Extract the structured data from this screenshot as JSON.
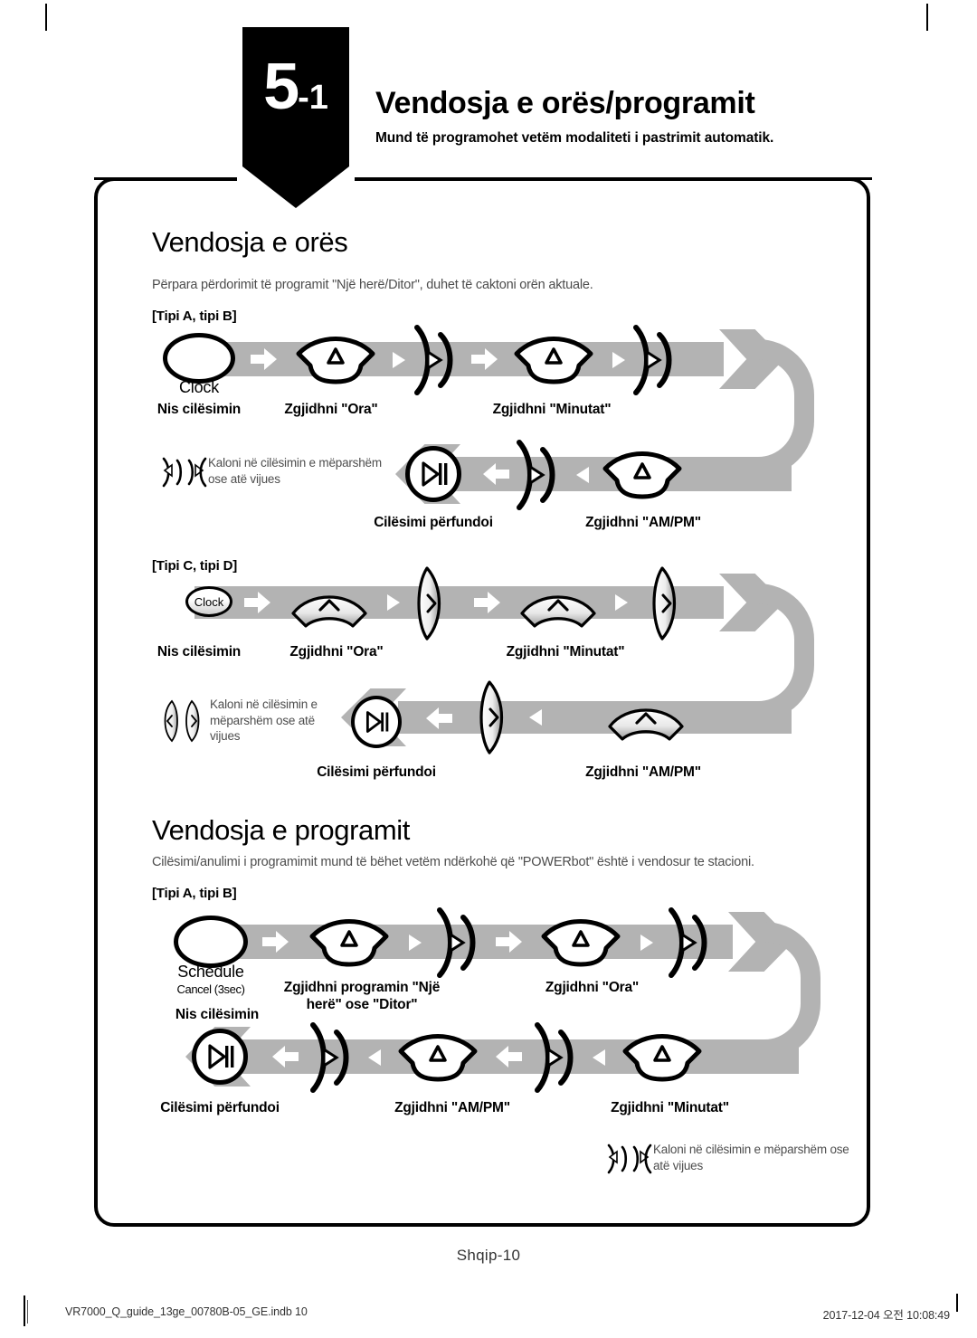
{
  "chapter": {
    "number": "5",
    "sub": "-1"
  },
  "header": {
    "title": "Vendosja e orës/programit",
    "subtitle": "Mund të programohet vetëm modaliteti i pastrimit automatik."
  },
  "sections": [
    {
      "id": "clock",
      "title": "Vendosja e orës",
      "description": "Përpara përdorimit të programit \"Një herë/Ditor\", duhet të caktoni orën aktuale.",
      "groups": [
        {
          "type_label": "[Tipi A, tipi B]",
          "start_button": {
            "label": "Clock"
          },
          "legend": {
            "text": "Kaloni në cilësimin e mëparshëm ose atë vijues",
            "icons": "prev-next-arc-icons"
          },
          "steps_top": [
            "Nis cilësimin",
            "Zgjidhni \"Ora\"",
            "Zgjidhni \"Minutat\""
          ],
          "steps_bottom": [
            "Cilësimi përfundoi",
            "Zgjidhni \"AM/PM\""
          ]
        },
        {
          "type_label": "[Tipi C, tipi D]",
          "start_button": {
            "label": "Clock"
          },
          "legend": {
            "text": "Kaloni në cilësimin e mëparshëm ose atë vijues",
            "icons": "prev-next-diamond-icons"
          },
          "steps_top": [
            "Nis cilësimin",
            "Zgjidhni \"Ora\"",
            "Zgjidhni \"Minutat\""
          ],
          "steps_bottom": [
            "Cilësimi përfundoi",
            "Zgjidhni \"AM/PM\""
          ]
        }
      ]
    },
    {
      "id": "schedule",
      "title": "Vendosja e programit",
      "description": "Cilësimi/anulimi i programimit mund të bëhet vetëm ndërkohë që \"POWERbot\" është i vendosur te stacioni.",
      "groups": [
        {
          "type_label": "[Tipi A, tipi B]",
          "start_button": {
            "label": "Schedule",
            "sublabel": "Cancel (3sec)"
          },
          "legend": {
            "text": "Kaloni në cilësimin e mëparshëm ose atë vijues",
            "icons": "prev-next-arc-icons"
          },
          "steps_top": [
            "Nis cilësimin",
            "Zgjidhni programin \"Një herë\" ose \"Ditor\"",
            "Zgjidhni \"Ora\""
          ],
          "steps_bottom": [
            "Cilësimi përfundoi",
            "Zgjidhni \"AM/PM\"",
            "Zgjidhni \"Minutat\""
          ]
        }
      ]
    }
  ],
  "folio": "Shqip-10",
  "print_footer": {
    "left": "VR7000_Q_guide_13ge_00780B-05_GE.indb   10",
    "right": "2017-12-04   오전 10:08:49"
  },
  "colors": {
    "ribbon": "#b3b3b3",
    "ink": "#000000",
    "body_text": "#4d4d4d"
  }
}
